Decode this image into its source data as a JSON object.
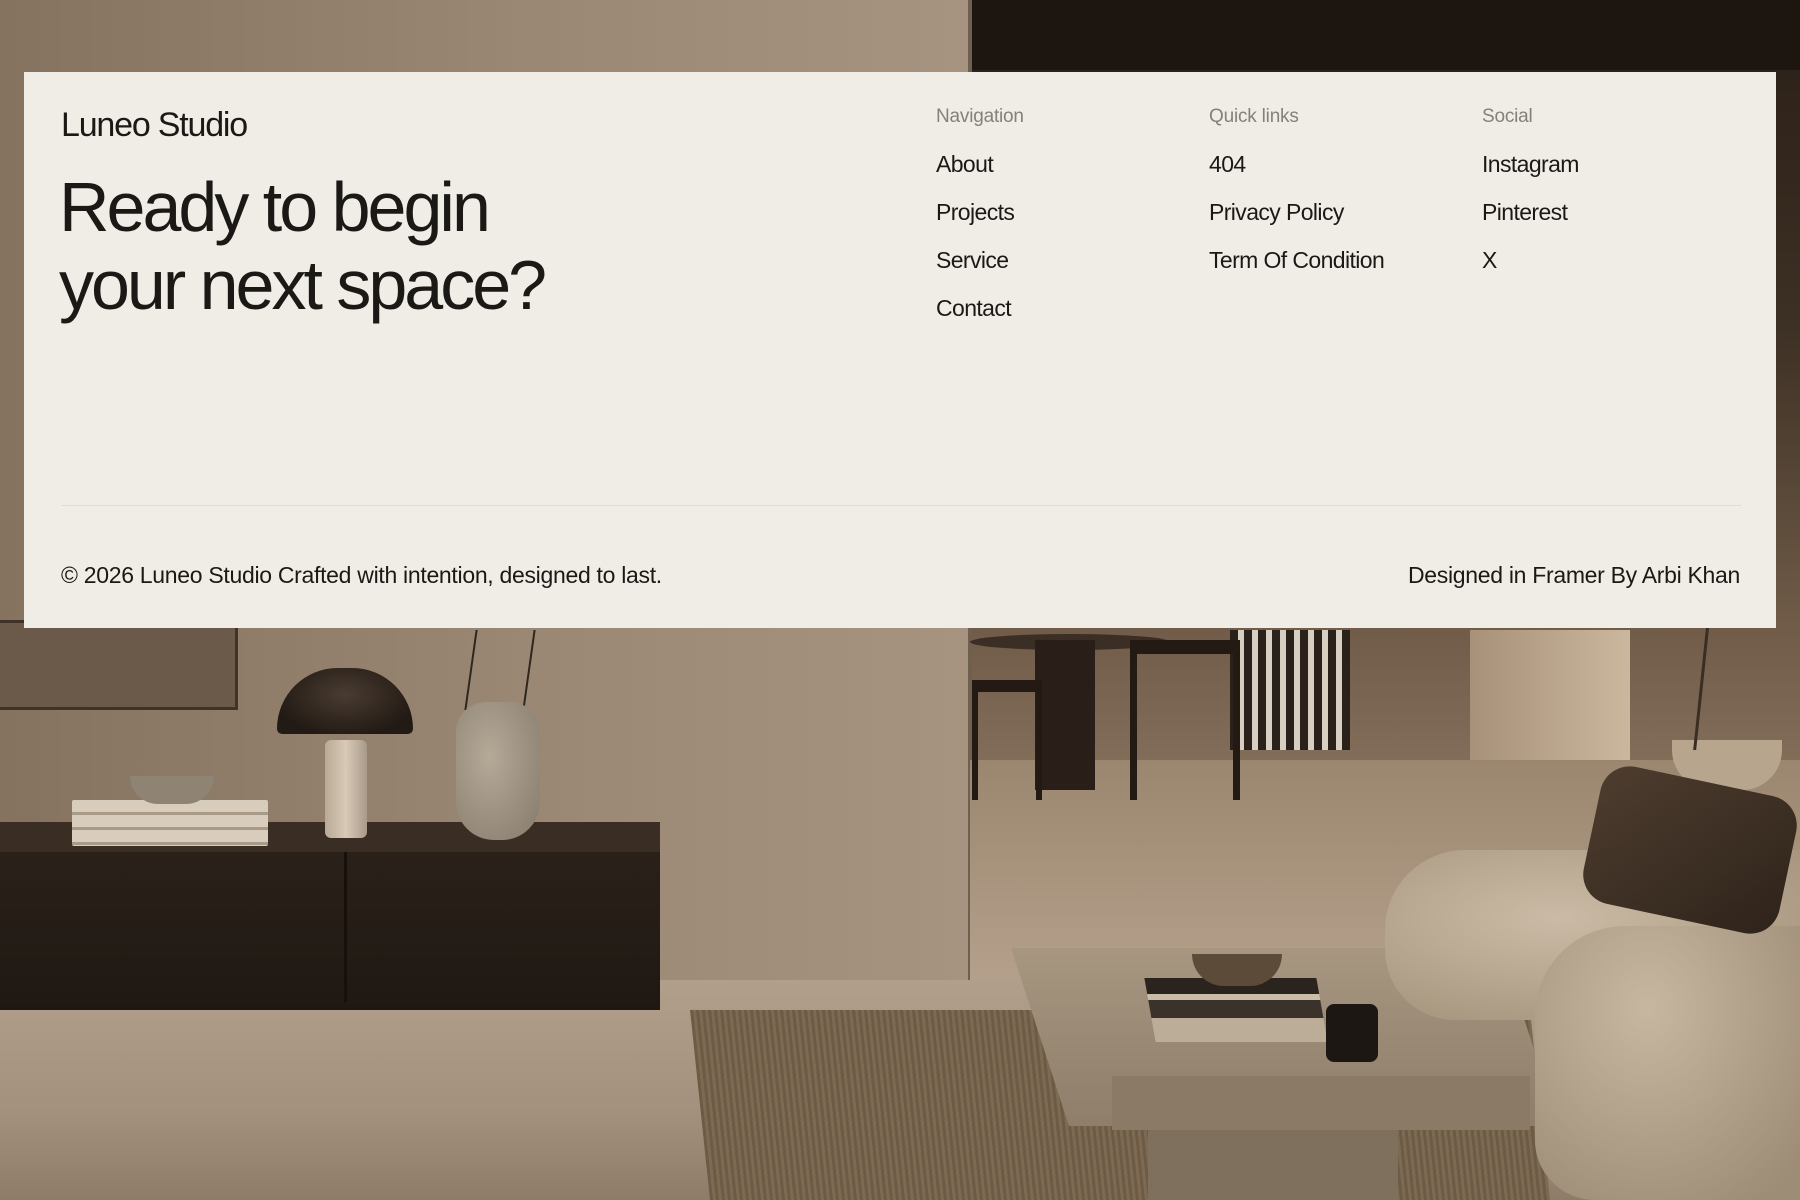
{
  "background": {
    "description_icon": "interior-living-room-photo"
  },
  "footer": {
    "brand": "Luneo Studio",
    "headline_line1": "Ready to begin",
    "headline_line2": "your next space?",
    "columns": [
      {
        "title": "Navigation",
        "links": [
          "About",
          "Projects",
          "Service",
          "Contact"
        ]
      },
      {
        "title": "Quick links",
        "links": [
          "404",
          "Privacy Policy",
          "Term Of Condition"
        ]
      },
      {
        "title": "Social",
        "links": [
          "Instagram",
          "Pinterest",
          "X"
        ]
      }
    ],
    "copyright": "© 2026 Luneo Studio Crafted with intention, designed to last.",
    "credit": "Designed in Framer By Arbi Khan"
  },
  "colors": {
    "card_background": "#f0ece6",
    "text_primary": "#1b1916",
    "text_muted": "#85807a"
  }
}
